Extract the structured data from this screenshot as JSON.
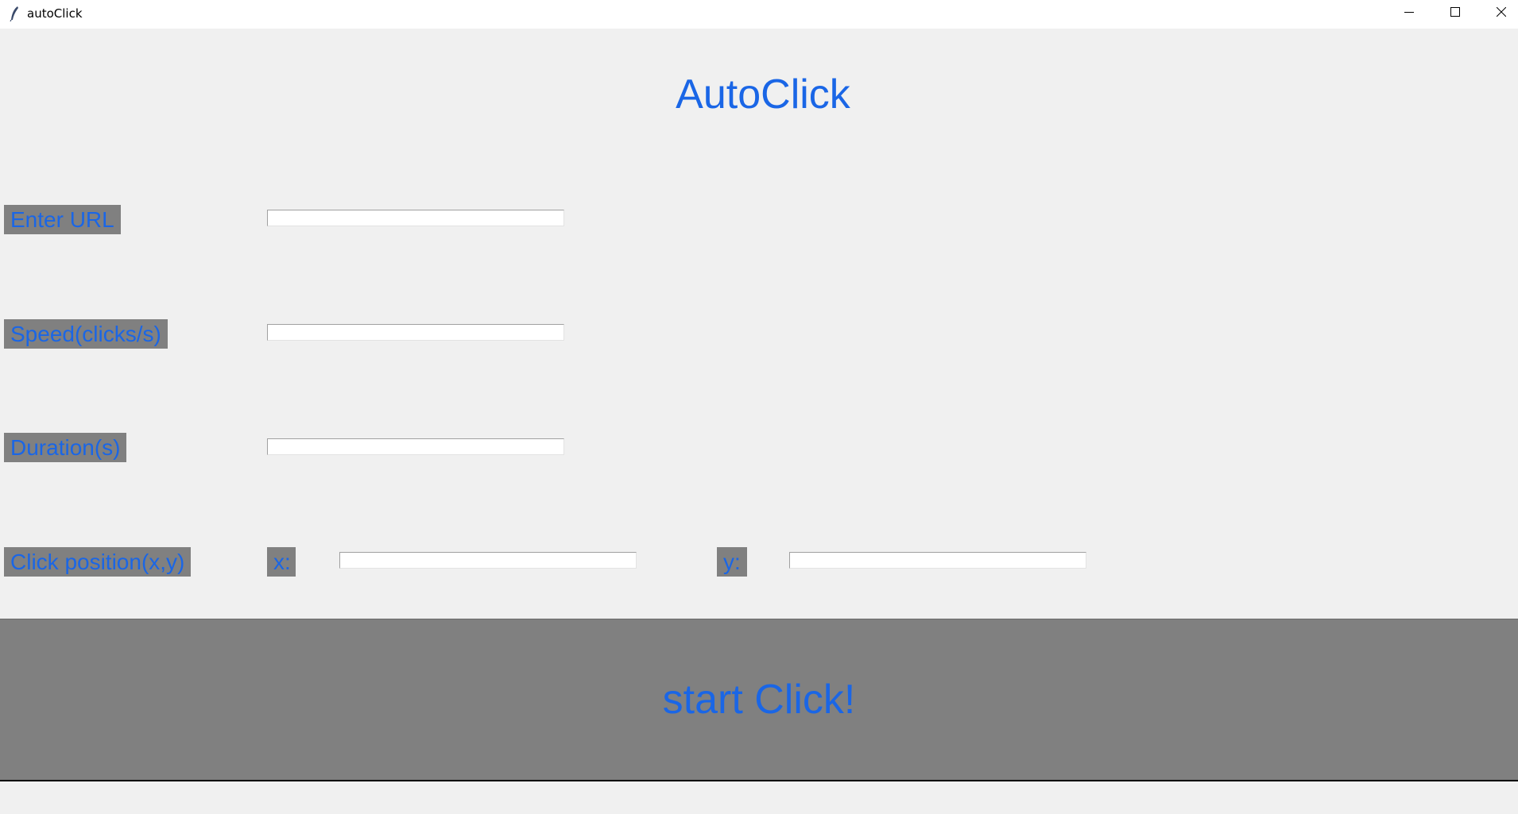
{
  "window": {
    "title": "autoClick",
    "controls": {
      "minimize": "minimize-icon",
      "maximize": "maximize-icon",
      "close": "close-icon"
    }
  },
  "app": {
    "heading": "AutoClick",
    "accent_color": "#1a66e6",
    "label_bg": "#808080"
  },
  "form": {
    "url_label": "Enter URL",
    "url_value": "",
    "speed_label": "Speed(clicks/s)",
    "speed_value": "",
    "duration_label": "Duration(s)",
    "duration_value": "",
    "position_label": "Click position(x,y)",
    "x_label": "x:",
    "x_value": "",
    "y_label": "y:",
    "y_value": ""
  },
  "actions": {
    "start_label": "start Click!"
  }
}
